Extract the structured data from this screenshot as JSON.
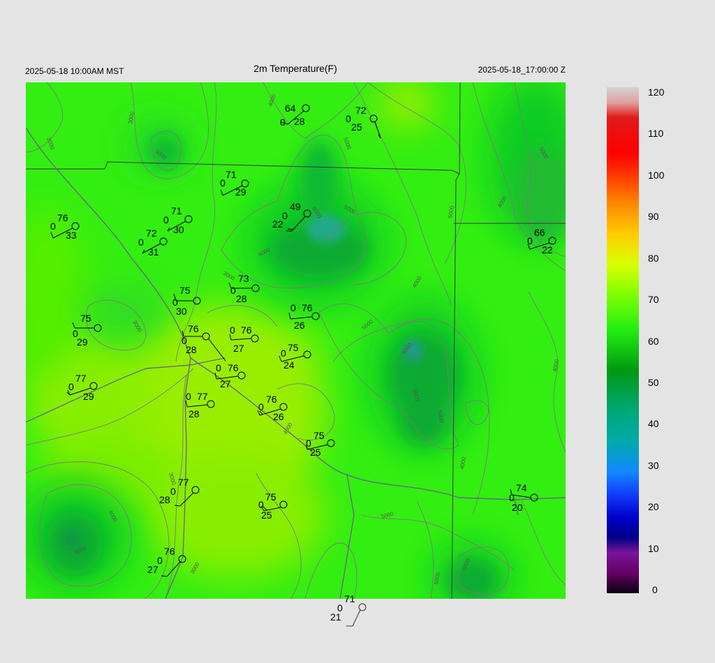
{
  "header": {
    "local_time": "2025-05-18 10:00AM MST",
    "title": "2m Temperature(F)",
    "valid_time": "2025-05-18_17:00:00 Z"
  },
  "colorbar": {
    "labels": [
      "120",
      "110",
      "100",
      "90",
      "80",
      "70",
      "60",
      "50",
      "40",
      "30",
      "20",
      "10",
      "0"
    ],
    "min": 0,
    "max": 120
  },
  "contour_labels": [
    "2000",
    "3000",
    "5000",
    "4000",
    "5000",
    "6000",
    "5000",
    "6000",
    "5000",
    "4000",
    "5000",
    "3000",
    "4000",
    "3000",
    "5000",
    "4000",
    "6000",
    "4000",
    "5000",
    "6000",
    "3000",
    "4000",
    "4000",
    "5000",
    "6000",
    "5000",
    "3000",
    "5000"
  ],
  "stations": [
    {
      "temp": "64",
      "dew": "28",
      "vis": "0"
    },
    {
      "temp": "72",
      "dew": "25",
      "vis": "0"
    },
    {
      "temp": "71",
      "dew": "29",
      "vis": "0"
    },
    {
      "temp": "49",
      "dew": "22",
      "vis": "0"
    },
    {
      "temp": "76",
      "dew": "33",
      "vis": "0"
    },
    {
      "temp": "71",
      "dew": "30",
      "vis": "0"
    },
    {
      "temp": "72",
      "dew": "31",
      "vis": "0"
    },
    {
      "temp": "66",
      "dew": "22",
      "vis": "0"
    },
    {
      "temp": "73",
      "dew": "28",
      "vis": "0"
    },
    {
      "temp": "75",
      "dew": "30",
      "vis": "0"
    },
    {
      "temp": "76",
      "dew": "26",
      "vis": "0"
    },
    {
      "temp": "75",
      "dew": "29",
      "vis": "0"
    },
    {
      "temp": "76",
      "dew": "28",
      "vis": "0"
    },
    {
      "temp": "76",
      "dew": "27",
      "vis": "0"
    },
    {
      "temp": "75",
      "dew": "24",
      "vis": "0"
    },
    {
      "temp": "77",
      "dew": "29",
      "vis": "0"
    },
    {
      "temp": "76",
      "dew": "27",
      "vis": "0"
    },
    {
      "temp": "77",
      "dew": "28",
      "vis": "0"
    },
    {
      "temp": "76",
      "dew": "26",
      "vis": "0"
    },
    {
      "temp": "75",
      "dew": "25",
      "vis": "0"
    },
    {
      "temp": "77",
      "dew": "28",
      "vis": "0"
    },
    {
      "temp": "75",
      "dew": "25",
      "vis": "0"
    },
    {
      "temp": "74",
      "dew": "20",
      "vis": "0"
    },
    {
      "temp": "76",
      "dew": "27",
      "vis": "0"
    },
    {
      "temp": "71",
      "dew": "21",
      "vis": "0"
    }
  ]
}
